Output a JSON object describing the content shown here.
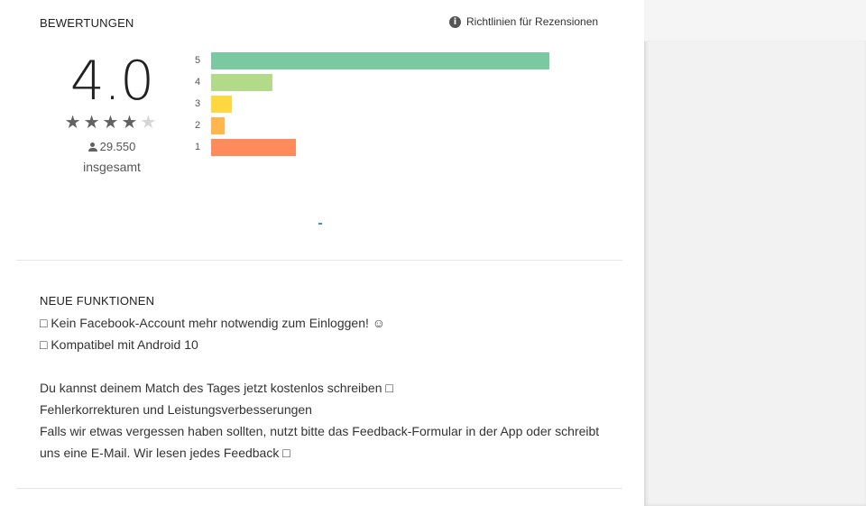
{
  "ratings": {
    "section_title": "BEWERTUNGEN",
    "policy_link_label": "Richtlinien für Rezensionen",
    "score": "4.0",
    "stars_filled": 4,
    "stars_total": 5,
    "review_count": "29.550",
    "total_label": "insgesamt",
    "histogram": [
      {
        "label": "5",
        "fraction": 0.7,
        "color": "#7bc9a0"
      },
      {
        "label": "4",
        "fraction": 0.127,
        "color": "#b2da88"
      },
      {
        "label": "3",
        "fraction": 0.043,
        "color": "#ffd740"
      },
      {
        "label": "2",
        "fraction": 0.028,
        "color": "#ffb74d"
      },
      {
        "label": "1",
        "fraction": 0.175,
        "color": "#ff8a5b"
      }
    ]
  },
  "whats_new": {
    "title": "NEUE FUNKTIONEN",
    "lines": [
      "□ Kein Facebook-Account mehr notwendig zum Einloggen! ☺",
      "□ Kompatibel mit Android 10",
      "",
      "Du kannst deinem Match des Tages jetzt kostenlos schreiben □",
      "Fehlerkorrekturen und Leistungsverbesserungen",
      "Falls wir etwas vergessen haben sollten, nutzt bitte das Feedback-Formular in der App oder schreibt",
      "uns eine E-Mail. Wir lesen jedes Feedback □"
    ]
  },
  "icons": {
    "info": "info-icon",
    "star": "star-icon",
    "person": "person-icon"
  }
}
